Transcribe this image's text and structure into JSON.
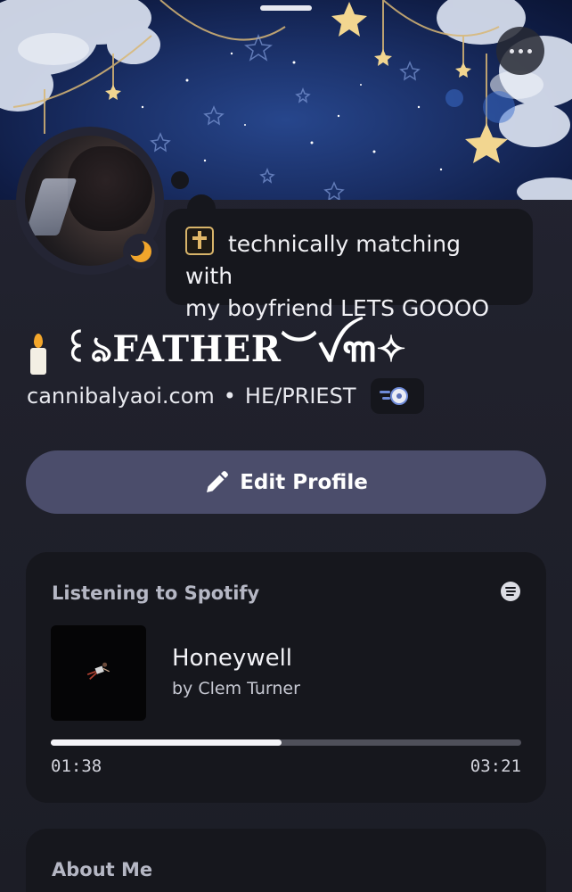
{
  "header": {
    "more_menu_icon": "more-horizontal-icon"
  },
  "profile": {
    "status_emoji": "cross-emoji",
    "status_text": "technically matching with my boyfriend LETS GOOOO",
    "status_line1": "technically matching with",
    "status_line2": "my boyfriend LETS GOOOO",
    "presence_icon": "moon-idle-icon",
    "display_name_emoji": "candle-emoji",
    "display_name": "꒰⁠ঌFATHER︶ꪜ꧑✧",
    "website": "cannibalyaoi.com",
    "separator": "•",
    "pronouns": "HE/PRIEST",
    "badge_icon": "hypesquad-badge-icon"
  },
  "actions": {
    "edit_profile_label": "Edit Profile",
    "edit_icon": "pencil-icon"
  },
  "spotify": {
    "section_title": "Listening to Spotify",
    "icon": "spotify-icon",
    "track_title": "Honeywell",
    "artist_line": "by Clem Turner",
    "elapsed": "01:38",
    "duration": "03:21",
    "progress_fraction": 0.49
  },
  "about": {
    "section_title": "About Me"
  },
  "colors": {
    "background": "#20212c",
    "card": "#16171d",
    "button": "#4b4d6b",
    "banner": "#1a2f66"
  }
}
